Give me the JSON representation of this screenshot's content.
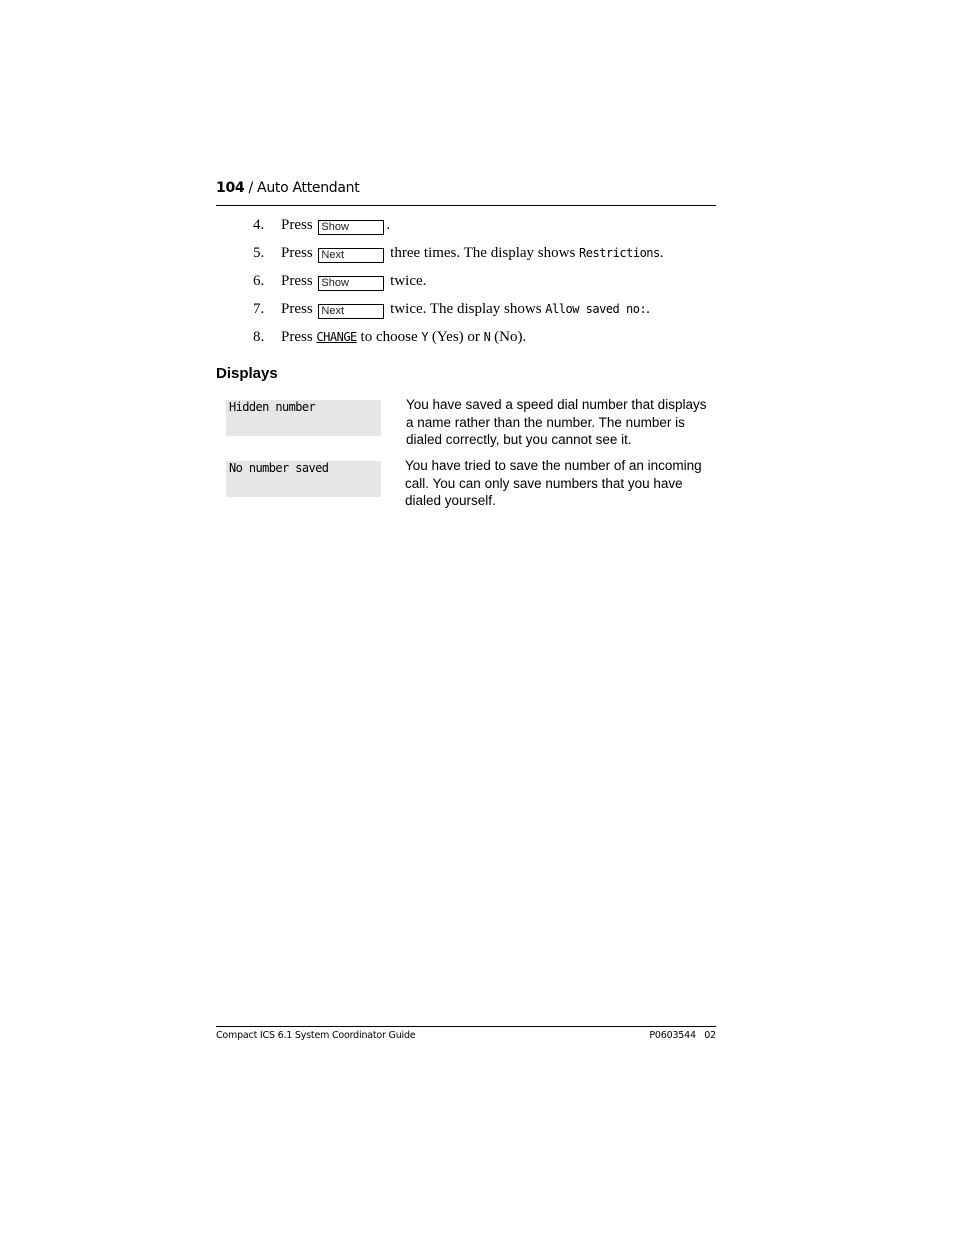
{
  "header": {
    "page_number": "104",
    "separator": " / ",
    "section": "Auto Attendant"
  },
  "steps": [
    {
      "num": "4.",
      "pre": "Press ",
      "key": "Show",
      "post": "."
    },
    {
      "num": "5.",
      "pre": "Press ",
      "key": "Next",
      "post": " three times. The display shows ",
      "lcd": "Restrictions",
      "post2": "."
    },
    {
      "num": "6.",
      "pre": "Press ",
      "key": "Show",
      "post": " twice."
    },
    {
      "num": "7.",
      "pre": "Press ",
      "key": "Next",
      "post": " twice. The display shows ",
      "lcd": "Allow saved no:",
      "post2": "."
    },
    {
      "num": "8.",
      "pre": "Press ",
      "softkey": "CHANGE",
      "post": " to choose ",
      "y": "Y",
      "yes": " (Yes) or ",
      "n": "N",
      "no": " (No)."
    }
  ],
  "displays_section": {
    "title": "Displays",
    "items": [
      {
        "display": "Hidden number",
        "description": "You have saved a speed dial number that displays a name rather than the number. The number is dialed correctly, but you cannot see it."
      },
      {
        "display": "No number saved",
        "description": "You have tried to save the number of an incoming call. You can only save numbers that you have dialed yourself."
      }
    ]
  },
  "footer": {
    "left": "Compact ICS 6.1 System Coordinator Guide",
    "right": "P0603544   02"
  }
}
